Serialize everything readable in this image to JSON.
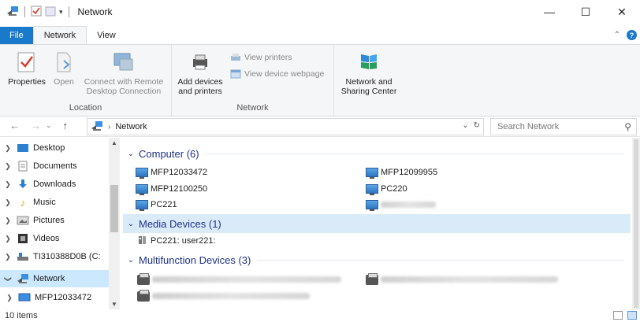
{
  "window": {
    "title": "Network",
    "minimize": "—",
    "maximize": "☐",
    "close": "✕"
  },
  "ribbon_tabs": [
    "File",
    "Network",
    "View"
  ],
  "ribbon": {
    "location_group": {
      "label": "Location",
      "properties": "Properties",
      "open": "Open",
      "connect_line1": "Connect with Remote",
      "connect_line2": "Desktop Connection"
    },
    "network_group": {
      "label": "Network",
      "add_line1": "Add devices",
      "add_line2": "and printers",
      "view_printers": "View printers",
      "view_webpage": "View device webpage",
      "center_line1": "Network and",
      "center_line2": "Sharing Center"
    }
  },
  "address": {
    "path": "Network",
    "search_placeholder": "Search Network"
  },
  "nav_pane": {
    "items": [
      {
        "label": "Desktop",
        "icon": "desktop-icon"
      },
      {
        "label": "Documents",
        "icon": "documents-icon"
      },
      {
        "label": "Downloads",
        "icon": "downloads-icon"
      },
      {
        "label": "Music",
        "icon": "music-icon"
      },
      {
        "label": "Pictures",
        "icon": "pictures-icon"
      },
      {
        "label": "Videos",
        "icon": "videos-icon"
      },
      {
        "label": "TI310388D0B (C:",
        "icon": "drive-icon"
      },
      {
        "label": "Network",
        "icon": "network-icon"
      },
      {
        "label": "MFP12033472",
        "icon": "computer-icon"
      }
    ]
  },
  "groups": {
    "computer": {
      "header": "Computer (6)",
      "items": [
        "MFP12033472",
        "MFP12099955",
        "MFP12100250",
        "PC220",
        "PC221"
      ]
    },
    "media": {
      "header": "Media Devices (1)",
      "items": [
        "PC221: user221:"
      ]
    },
    "multifunction": {
      "header": "Multifunction Devices (3)"
    }
  },
  "status": {
    "item_count": "10 items"
  },
  "colors": {
    "accent": "#1979ca",
    "selection": "#cce8ff",
    "group_header_text": "#1e3287"
  }
}
